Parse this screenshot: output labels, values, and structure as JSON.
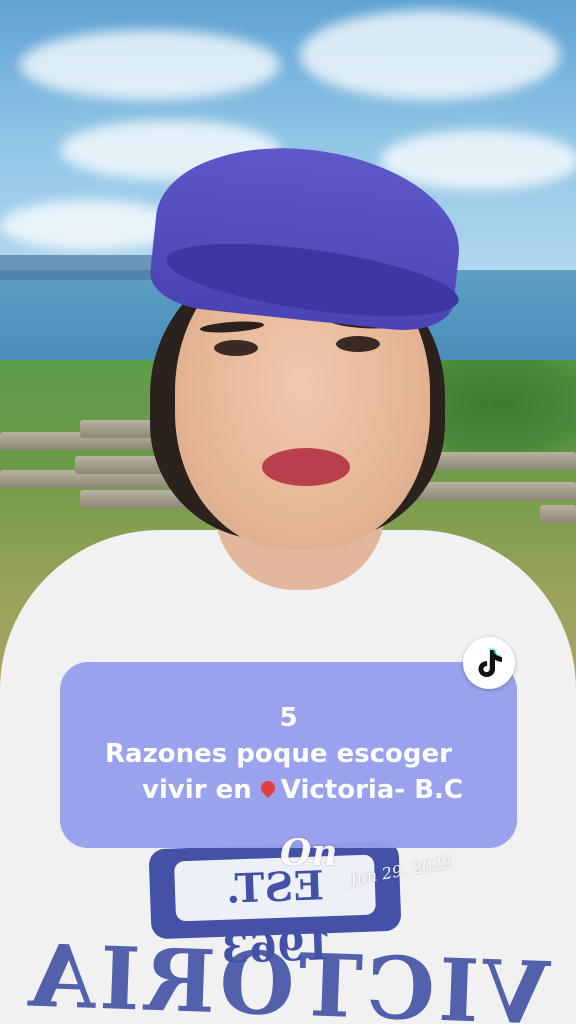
{
  "video": {
    "scene": "selfie-video-background"
  },
  "overlay": {
    "line1": "5",
    "line2": "Razones poque escoger",
    "line3_prefix": "vivir en ",
    "line3_pin_icon": "red-pin-icon",
    "line3_suffix": "Victoria- B.C",
    "background_color": "#969EEC",
    "text_color": "#FFFFFF"
  },
  "badge": {
    "icon": "tiktok-logo-icon"
  },
  "watermark": {
    "script_text": "On",
    "date": "Jun 29, 2022"
  },
  "shirt": {
    "print_top": "EST. 1963",
    "print_bottom": "VICTORIA"
  }
}
